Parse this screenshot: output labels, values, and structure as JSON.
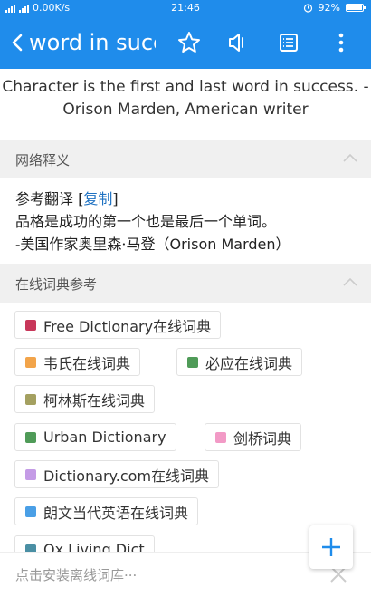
{
  "status_bar": {
    "carrier_icons": "移动信号",
    "speed": "0.00K/s",
    "time": "21:46",
    "battery": "92%"
  },
  "app_bar": {
    "title": "word in success"
  },
  "quote": {
    "text": "Character is the first and last word in success. -Orison Marden, American writer"
  },
  "web_definition": {
    "header": "网络释义",
    "prefix": "参考翻译 [",
    "copy_link": "复制",
    "suffix": "]",
    "line1": "品格是成功的第一个也是最后一个单词。",
    "line2_cn": "-美国作家奥里森·马登（",
    "line2_en": "Orison Marden",
    "line2_end": "）"
  },
  "online_dicts": {
    "header": "在线词典参考",
    "items": [
      {
        "label": "Free Dictionary在线词典",
        "color": "#c8375a"
      },
      {
        "label": "韦氏在线词典",
        "color": "#f2a44a"
      },
      {
        "label": "必应在线词典",
        "color": "#4f9b58"
      },
      {
        "label": "柯林斯在线词典",
        "color": "#a4a060"
      },
      {
        "label": "Urban Dictionary",
        "color": "#4f9b58"
      },
      {
        "label": "剑桥词典",
        "color": "#f29ac6"
      },
      {
        "label": "Dictionary.com在线词典",
        "color": "#c49be6"
      },
      {
        "label": "朗文当代英语在线词典",
        "color": "#4a9fe6"
      },
      {
        "label": "Ox Living Dict",
        "color": "#4a8fa4"
      }
    ]
  },
  "bottom_bar": {
    "hint": "点击安装离线词库···"
  },
  "colors": {
    "primary": "#1f8ceb",
    "link": "#1f72c2"
  }
}
